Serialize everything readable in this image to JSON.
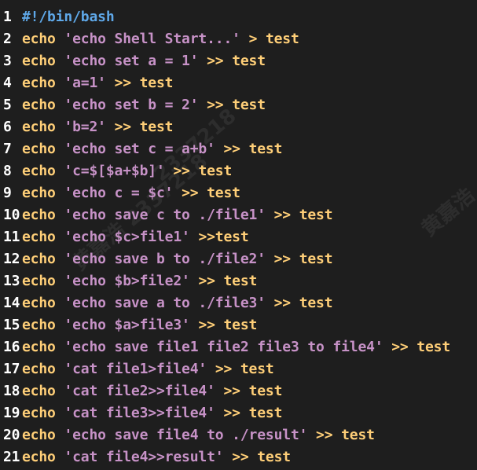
{
  "editor": {
    "watermarks": [
      "黄嘉浩 2337218",
      "2337218",
      "黄嘉浩"
    ],
    "lines": [
      {
        "n": "1",
        "shebang": "#!/bin/bash"
      },
      {
        "n": "2",
        "cmd": "echo",
        "str": "'echo Shell Start...'",
        "op": ">",
        "target": "test"
      },
      {
        "n": "3",
        "cmd": "echo",
        "str": "'echo set a = 1'",
        "op": ">>",
        "target": "test"
      },
      {
        "n": "4",
        "cmd": "echo",
        "str": "'a=1'",
        "op": ">>",
        "target": "test"
      },
      {
        "n": "5",
        "cmd": "echo",
        "str": "'echo set b = 2'",
        "op": ">>",
        "target": "test"
      },
      {
        "n": "6",
        "cmd": "echo",
        "str": "'b=2'",
        "op": ">>",
        "target": "test"
      },
      {
        "n": "7",
        "cmd": "echo",
        "str": "'echo set c = a+b'",
        "op": ">>",
        "target": "test"
      },
      {
        "n": "8",
        "cmd": "echo",
        "str": "'c=$[$a+$b]'",
        "op": ">>",
        "target": "test"
      },
      {
        "n": "9",
        "cmd": "echo",
        "str": "'echo c = $c'",
        "op": ">>",
        "target": "test"
      },
      {
        "n": "10",
        "cmd": "echo",
        "str": "'echo save c to ./file1'",
        "op": ">>",
        "target": "test"
      },
      {
        "n": "11",
        "cmd": "echo",
        "str": "'echo $c>file1'",
        "op": ">>test",
        "target": ""
      },
      {
        "n": "12",
        "cmd": "echo",
        "str": "'echo save b to ./file2'",
        "op": ">>",
        "target": "test"
      },
      {
        "n": "13",
        "cmd": "echo",
        "str": "'echo $b>file2'",
        "op": ">>",
        "target": "test"
      },
      {
        "n": "14",
        "cmd": "echo",
        "str": "'echo save a to ./file3'",
        "op": ">>",
        "target": "test"
      },
      {
        "n": "15",
        "cmd": "echo",
        "str": "'echo $a>file3'",
        "op": ">>",
        "target": "test"
      },
      {
        "n": "16",
        "cmd": "echo",
        "str": "'echo save file1 file2 file3 to file4'",
        "op": ">>",
        "target": "test"
      },
      {
        "n": "17",
        "cmd": "echo",
        "str": "'cat file1>file4'",
        "op": ">>",
        "target": "test"
      },
      {
        "n": "18",
        "cmd": "echo",
        "str": "'cat file2>>file4'",
        "op": ">>",
        "target": "test"
      },
      {
        "n": "19",
        "cmd": "echo",
        "str": "'cat file3>>file4'",
        "op": ">>",
        "target": "test"
      },
      {
        "n": "20",
        "cmd": "echo",
        "str": "'echo save file4 to ./result'",
        "op": ">>",
        "target": "test"
      },
      {
        "n": "21",
        "cmd": "echo",
        "str": "'cat file4>>result'",
        "op": ">>",
        "target": "test"
      }
    ]
  }
}
